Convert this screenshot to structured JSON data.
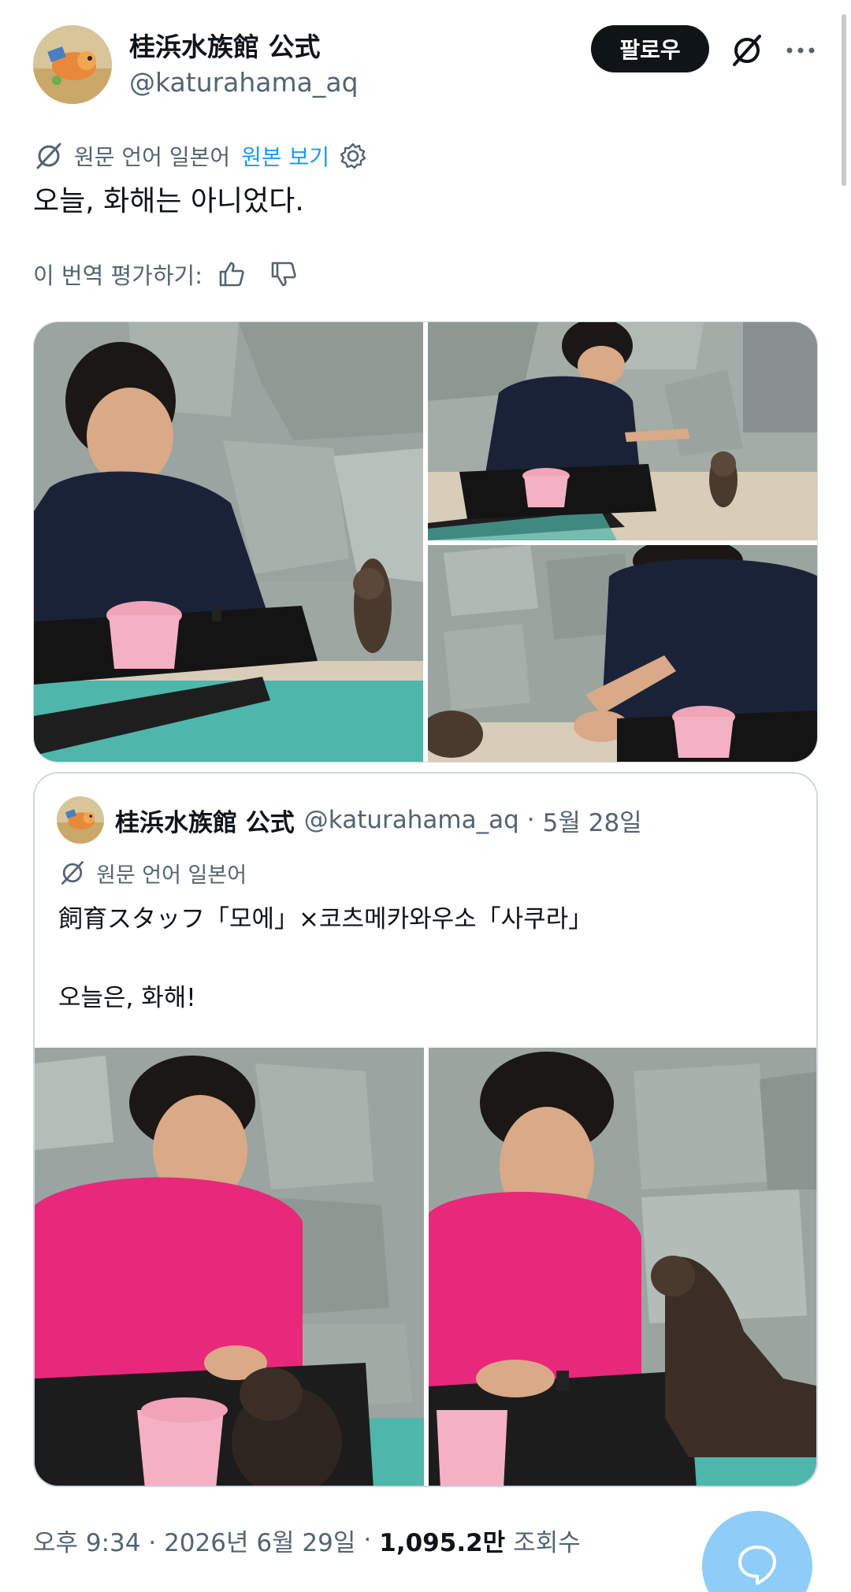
{
  "post": {
    "display_name": "桂浜水族館 公式",
    "handle": "@katurahama_aq",
    "follow_label": "팔로우",
    "translation_note": "원문 언어 일본어",
    "show_original_label": "원본 보기",
    "text": "오늘, 화해는 아니었다.",
    "rate_translation_label": "이 번역 평가하기:",
    "timestamp": "오후 9:34 · 2026년 6월 29일",
    "separator": "·",
    "views_count": "1,095.2만",
    "views_label": "조회수"
  },
  "quote": {
    "display_name": "桂浜水族館 公式",
    "handle": "@katurahama_aq",
    "dot": "·",
    "date": "5월 28일",
    "translation_note": "원문 언어 일본어",
    "text_line1": "飼育スタッフ「모에」×코츠메카와우소「사쿠라」",
    "text_line2": "오늘은, 화해!"
  },
  "icons": {
    "grok": "grok-icon",
    "more": "more-icon",
    "translate": "translate-icon",
    "settings": "gear-icon",
    "thumbs_up": "thumbs-up-icon",
    "thumbs_down": "thumbs-down-icon",
    "compose": "compose-reply-icon"
  },
  "colors": {
    "accent": "#1d9bf0",
    "text_primary": "#0f1419",
    "text_secondary": "#536471",
    "fab": "#8ecdf8",
    "uniform_navy": "#1a2238",
    "uniform_pink": "#e8287a"
  }
}
